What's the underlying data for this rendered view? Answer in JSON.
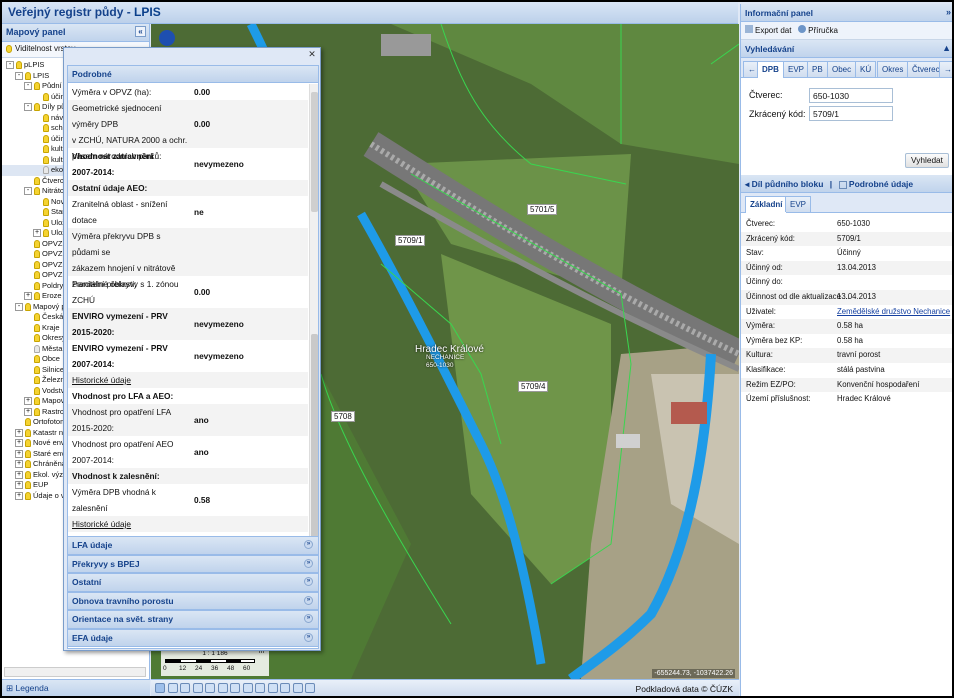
{
  "app": {
    "title_prefix": "Veřejný registr půdy - ",
    "title_app": "LPIS"
  },
  "left_panel": {
    "title": "Mapový panel",
    "visibility_label": "Viditelnost vrstev",
    "legend": "Legenda"
  },
  "tree": [
    {
      "label": "pLPIS",
      "lvl": 0,
      "exp": "-",
      "bulb": "on"
    },
    {
      "label": "LPIS",
      "lvl": 1,
      "exp": "-",
      "bulb": "on"
    },
    {
      "label": "Půdní b",
      "lvl": 2,
      "exp": "-",
      "bulb": "on"
    },
    {
      "label": "účin",
      "lvl": 3,
      "exp": "",
      "bulb": "on"
    },
    {
      "label": "Díly půd",
      "lvl": 2,
      "exp": "-",
      "bulb": "on"
    },
    {
      "label": "náv",
      "lvl": 3,
      "exp": "",
      "bulb": "on"
    },
    {
      "label": "sch",
      "lvl": 3,
      "exp": "",
      "bulb": "on"
    },
    {
      "label": "účin",
      "lvl": 3,
      "exp": "",
      "bulb": "on"
    },
    {
      "label": "kult",
      "lvl": 3,
      "exp": "",
      "bulb": "on"
    },
    {
      "label": "kult",
      "lvl": 3,
      "exp": "",
      "bulb": "on"
    },
    {
      "label": "eko",
      "lvl": 3,
      "exp": "",
      "bulb": "off",
      "sel": true
    },
    {
      "label": "Čtverc",
      "lvl": 2,
      "exp": "",
      "bulb": "on"
    },
    {
      "label": "Nitrátov",
      "lvl": 2,
      "exp": "-",
      "bulb": "on"
    },
    {
      "label": "Nov",
      "lvl": 3,
      "exp": "",
      "bulb": "on"
    },
    {
      "label": "Star",
      "lvl": 3,
      "exp": "",
      "bulb": "on"
    },
    {
      "label": "Ulož",
      "lvl": 3,
      "exp": "",
      "bulb": "on"
    },
    {
      "label": "Ulož",
      "lvl": 3,
      "exp": "+",
      "bulb": "on"
    },
    {
      "label": "OPVZ",
      "lvl": 2,
      "exp": "",
      "bulb": "on"
    },
    {
      "label": "OPVZ",
      "lvl": 2,
      "exp": "",
      "bulb": "on"
    },
    {
      "label": "OPVZ",
      "lvl": 2,
      "exp": "",
      "bulb": "on"
    },
    {
      "label": "OPVZ",
      "lvl": 2,
      "exp": "",
      "bulb": "on"
    },
    {
      "label": "Poldry",
      "lvl": 2,
      "exp": "",
      "bulb": "on"
    },
    {
      "label": "Eroze",
      "lvl": 2,
      "exp": "+",
      "bulb": "on"
    },
    {
      "label": "Mapový pc",
      "lvl": 1,
      "exp": "-",
      "bulb": "on"
    },
    {
      "label": "Česká",
      "lvl": 2,
      "exp": "",
      "bulb": "on"
    },
    {
      "label": "Kraje",
      "lvl": 2,
      "exp": "",
      "bulb": "on"
    },
    {
      "label": "Okresy",
      "lvl": 2,
      "exp": "",
      "bulb": "on"
    },
    {
      "label": "Města",
      "lvl": 2,
      "exp": "",
      "bulb": "off"
    },
    {
      "label": "Obce",
      "lvl": 2,
      "exp": "",
      "bulb": "on"
    },
    {
      "label": "Silnice",
      "lvl": 2,
      "exp": "",
      "bulb": "on"
    },
    {
      "label": "Železn",
      "lvl": 2,
      "exp": "",
      "bulb": "on"
    },
    {
      "label": "Vodstv",
      "lvl": 2,
      "exp": "",
      "bulb": "on"
    },
    {
      "label": "Mapov",
      "lvl": 2,
      "exp": "+",
      "bulb": "on"
    },
    {
      "label": "Rastrov",
      "lvl": 2,
      "exp": "+",
      "bulb": "on"
    },
    {
      "label": "Ortofotom",
      "lvl": 1,
      "exp": "",
      "bulb": "on"
    },
    {
      "label": "Katastr ne",
      "lvl": 1,
      "exp": "+",
      "bulb": "on"
    },
    {
      "label": "Nové envi",
      "lvl": 1,
      "exp": "+",
      "bulb": "on"
    },
    {
      "label": "Staré envi",
      "lvl": 1,
      "exp": "+",
      "bulb": "on"
    },
    {
      "label": "Chráněná",
      "lvl": 1,
      "exp": "+",
      "bulb": "on"
    },
    {
      "label": "Ekol. význ",
      "lvl": 1,
      "exp": "+",
      "bulb": "on"
    },
    {
      "label": "EUP",
      "lvl": 1,
      "exp": "+",
      "bulb": "on"
    },
    {
      "label": "Údaje o víc",
      "lvl": 1,
      "exp": "+",
      "bulb": "on"
    }
  ],
  "popup": {
    "section_main": "Podrobné",
    "rows": [
      {
        "k": [
          "Výměra v OPVZ (ha):"
        ],
        "v": "0.00",
        "h": 1
      },
      {
        "k": [
          "Geometrické sjednocení výměry DPB",
          "v ZCHÚ, NATURA 2000 a ochr.",
          "pásem národních parků:"
        ],
        "v": "0.00",
        "h": 3,
        "vline": 1
      },
      {
        "k": [
          "Vhodnost zatravnění",
          "2007-2014:"
        ],
        "v": "nevymezeno",
        "h": 2,
        "bold": 1
      },
      {
        "k": [
          "Ostatní údaje AEO:"
        ],
        "v": "",
        "h": 1,
        "bold": 1
      },
      {
        "k": [
          "Zranitelná oblast - snížení dotace",
          "AEO:"
        ],
        "v": "ne",
        "h": 2
      },
      {
        "k": [
          "Výměra překryvu DPB s půdami se",
          "zákazem hnojení v nitrátově",
          "zranitelné oblasti:"
        ],
        "v": "",
        "h": 3
      },
      {
        "k": [
          "Parciální překryvy s 1. zónou ZCHÚ",
          "(B4, B9, AEO-NIC):"
        ],
        "v": "0.00",
        "h": 2
      },
      {
        "k": [
          "ENVIRO vymezení - PRV",
          "2015-2020:"
        ],
        "v": "nevymezeno",
        "h": 2,
        "bold": 1
      },
      {
        "k": [
          "ENVIRO vymezení - PRV",
          "2007-2014:"
        ],
        "v": "nevymezeno",
        "h": 2,
        "bold": 1
      },
      {
        "k": [
          "Historické údaje"
        ],
        "v": "",
        "h": 1,
        "u": 1
      },
      {
        "k": [
          "Vhodnost pro LFA a AEO:"
        ],
        "v": "",
        "h": 1,
        "bold": 1
      },
      {
        "k": [
          "Vhodnost pro opatření LFA",
          "2015-2020:"
        ],
        "v": "ano",
        "h": 2
      },
      {
        "k": [
          "Vhodnost pro opatření AEO",
          "2007-2014:"
        ],
        "v": "ano",
        "h": 2
      },
      {
        "k": [
          "Vhodnost k zalesnění:"
        ],
        "v": "",
        "h": 1,
        "bold": 1
      },
      {
        "k": [
          "Výměra DPB vhodná k zalesnění",
          "(ha):"
        ],
        "v": "0.58",
        "h": 2
      },
      {
        "k": [
          "Historické údaje"
        ],
        "v": "",
        "h": 1,
        "u": 1
      }
    ],
    "sections": [
      "LFA údaje",
      "Překryvy s BPEJ",
      "Ostatní",
      "Obnova travního porostu",
      "Orientace na svět. strany",
      "EFA údaje"
    ]
  },
  "map": {
    "labels": [
      "5701/5",
      "5709/1",
      "5709/4",
      "5708"
    ],
    "town": "Hradec Králové",
    "town_sub1": "NECHANICE",
    "town_sub2": "650-1030",
    "scale_ratio": "1 : 1 186",
    "scale_ticks": [
      "0",
      "12",
      "24",
      "36",
      "48",
      "60"
    ],
    "scale_unit": "m",
    "coords": "-655244.73, -1037422.26",
    "basemap_label": "Podkladová data © ČÚZK"
  },
  "right": {
    "title": "Informační panel",
    "export": "Export dat",
    "help": "Příručka",
    "search_title": "Vyhledávání",
    "tabs": [
      "DPB",
      "EVP",
      "PB",
      "Obec",
      "KÚ",
      "Okres",
      "Čtverec"
    ],
    "ctverec_label": "Čtverec:",
    "ctverec_value": "650-1030",
    "kod_label": "Zkrácený kód:",
    "kod_value": "5709/1",
    "search_btn": "Vyhledat",
    "detail_header_left": "Díl půdního bloku",
    "detail_sep": "|",
    "detail_header_right": "Podrobné údaje",
    "detail_tabs": [
      "Základní",
      "EVP"
    ],
    "details": [
      {
        "k": "Čtverec:",
        "v": "650-1030"
      },
      {
        "k": "Zkrácený kód:",
        "v": "5709/1"
      },
      {
        "k": "Stav:",
        "v": "Účinný"
      },
      {
        "k": "Účinný od:",
        "v": "13.04.2013"
      },
      {
        "k": "Účinný do:",
        "v": ""
      },
      {
        "k": "Účinnost od dle aktualizace ...",
        "v": "13.04.2013"
      },
      {
        "k": "Uživatel:",
        "v": "Zemědělské družstvo Nechanice",
        "link": 1
      },
      {
        "k": "Výměra:",
        "v": "0.58 ha"
      },
      {
        "k": "Výměra bez KP:",
        "v": "0.58 ha"
      },
      {
        "k": "Kultura:",
        "v": "travní porost"
      },
      {
        "k": "Klasifikace:",
        "v": "stálá pastvina"
      },
      {
        "k": "Režim EZ/PO:",
        "v": "Konvenční hospodaření"
      },
      {
        "k": "Území příslušnost:",
        "v": "Hradec Králové"
      }
    ]
  },
  "colors": {
    "header_text": "#15428b",
    "river": "#1e9be8",
    "parcel_line": "#39d64f"
  }
}
